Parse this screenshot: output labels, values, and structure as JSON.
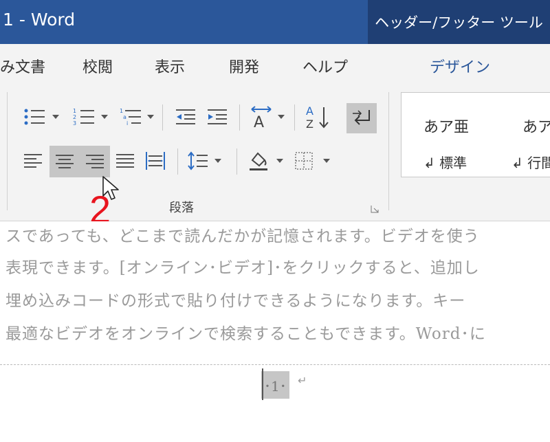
{
  "window": {
    "title": "1  -  Word",
    "context_tab": "ヘッダー/フッター ツール"
  },
  "tabs": [
    {
      "label": "み文書"
    },
    {
      "label": "校閲"
    },
    {
      "label": "表示"
    },
    {
      "label": "開発"
    },
    {
      "label": "ヘルプ"
    },
    {
      "label": "デザイン"
    }
  ],
  "ribbon": {
    "paragraph_group_label": "段落",
    "styles": [
      {
        "sample": "あア亜",
        "name": "↲ 標準"
      },
      {
        "sample": "あア",
        "name": "↲ 行間"
      }
    ]
  },
  "annotation": {
    "step": "2"
  },
  "document": {
    "lines": [
      "スであっても、どこまで読んだかが記憶されます。ビデオを使う",
      "表現できます。[オンライン･ビデオ]･をクリックすると、追加し",
      "埋め込みコードの形式で貼り付けできるようになります。キー",
      "最適なビデオをオンラインで検索することもできます。Word･に"
    ],
    "page_number": "･1･",
    "paragraph_mark": "↵"
  },
  "colors": {
    "titlebar": "#2b579a",
    "context_tab": "#1f3f74",
    "ribbon": "#f3f3f3",
    "pressed": "#c6c6c6",
    "annotation": "#e8141e"
  }
}
